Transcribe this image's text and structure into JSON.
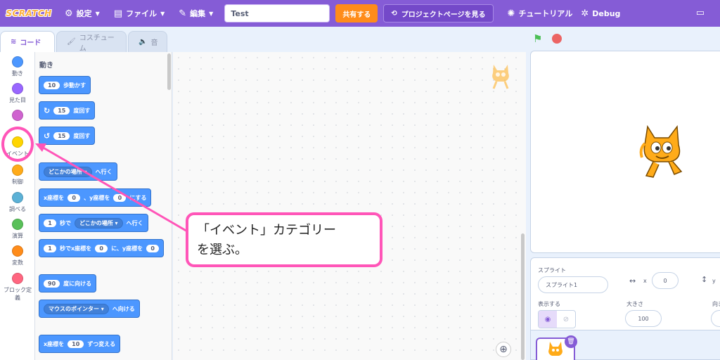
{
  "menubar": {
    "logo": "SCRATCH",
    "settings": "設定",
    "file": "ファイル",
    "edit": "編集",
    "title_value": "Test",
    "share": "共有する",
    "project_page": "プロジェクトページを見る",
    "tutorial": "チュートリアル",
    "debug": "Debug"
  },
  "tabs": [
    {
      "label": "コード",
      "icon": "code-icon"
    },
    {
      "label": "コスチューム",
      "icon": "brush-icon"
    },
    {
      "label": "音",
      "icon": "speaker-icon"
    }
  ],
  "categories": [
    {
      "label": "動き",
      "color": "#4c97ff"
    },
    {
      "label": "見た目",
      "color": "#9966ff"
    },
    {
      "label": "",
      "color": "#cf63cf"
    },
    {
      "label": "イベント",
      "color": "#ffd500"
    },
    {
      "label": "制御",
      "color": "#ffab19"
    },
    {
      "label": "調べる",
      "color": "#5cb1d6"
    },
    {
      "label": "演算",
      "color": "#59c059"
    },
    {
      "label": "変数",
      "color": "#ff8c1a"
    },
    {
      "label": "ブロック定義",
      "color": "#ff6680"
    }
  ],
  "palette": {
    "heading": "動き",
    "move": {
      "value": "10",
      "text": "歩動かす"
    },
    "turn_right": {
      "value": "15",
      "text": "度回す"
    },
    "turn_left": {
      "value": "15",
      "text": "度回す"
    },
    "goto": {
      "dropdown": "どこかの場所",
      "text": "へ行く"
    },
    "gotoxy": {
      "pre": "x座標を",
      "x": "0",
      "mid": "、y座標を",
      "y": "0",
      "post": "にする"
    },
    "glide": {
      "value": "1",
      "pre": "秒で",
      "dropdown": "どこかの場所",
      "post": "へ行く"
    },
    "glidexy": {
      "value": "1",
      "pre": "秒でx座標を",
      "x": "0",
      "mid": "に、y座標を",
      "y": "0"
    },
    "point": {
      "value": "90",
      "text": "度に向ける"
    },
    "pointto": {
      "dropdown": "マウスのポインター",
      "text": "へ向ける"
    },
    "changex": {
      "pre": "x座標を",
      "value": "10",
      "post": "ずつ変える"
    }
  },
  "sprite_info": {
    "sprite_label": "スプライト",
    "sprite_name": "スプライト1",
    "x_label": "x",
    "x_value": "0",
    "y_label": "y",
    "show_label": "表示する",
    "size_label": "大きさ",
    "size_value": "100",
    "direction_label": "向き"
  },
  "annotation": {
    "line1": "「イベント」カテゴリー",
    "line2": "を選ぶ。",
    "color": "#ff55b8"
  }
}
